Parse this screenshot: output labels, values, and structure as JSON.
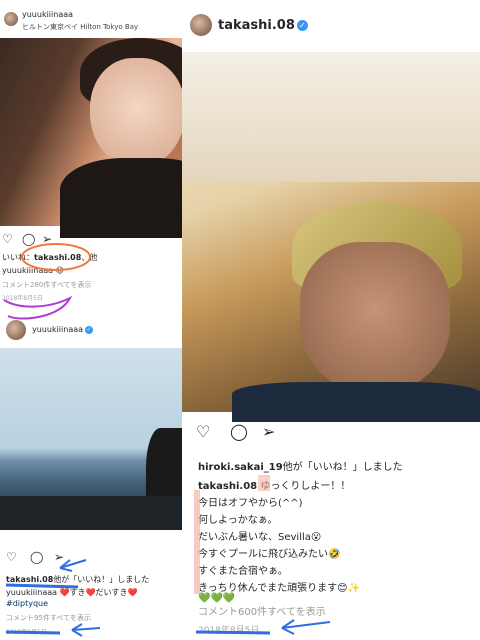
{
  "post_a": {
    "username": "yuuukiiinaaa",
    "location": "ヒルトン東京ベイ Hilton Tokyo Bay",
    "more_icon": "more-vertical-icon",
    "likes_prefix": "いいね：",
    "likes_user": "takashi.08",
    "likes_suffix": "、他",
    "caption": "yuuukiiinaaa 😉",
    "comments_link": "コメント280件すべてを表示",
    "date": "2018年8月5日"
  },
  "post_b": {
    "username": "yuuukiiinaaa",
    "likes_user": "takashi.08",
    "likes_suffix": "他が「いいね！」しました",
    "caption": "yuuukiiinaaa ❤️すき❤️だいすき❤️",
    "hashtag": "#diptyque",
    "comments_link": "コメント95件すべてを表示",
    "date": "2018年8月5日"
  },
  "post_c": {
    "username": "takashi.08",
    "likes_user": "hiroki.sakai_19",
    "likes_suffix": "他が「いいね！」しました",
    "caption_user": "takashi.08",
    "caption_lines": [
      "ゆっくりしよー！！",
      "今日はオフやから(^^)",
      "何しよっかなぁ。",
      "だいぶん暑いな、Sevilla😮",
      "今すぐプールに飛び込みたい🤣",
      "すぐまた合宿やぁ。",
      "きっちり休んでまた頑張ります😊✨",
      "💚💚💚"
    ],
    "comments_link": "コメント600件すべてを表示",
    "date": "2018年8月5日"
  },
  "colors": {
    "annotation_orange": "#f07a3a",
    "annotation_purple": "#b23bd6",
    "annotation_blue": "#2f6de0",
    "annotation_red_highlight": "#f3b3a6",
    "verified": "#3897f0"
  }
}
